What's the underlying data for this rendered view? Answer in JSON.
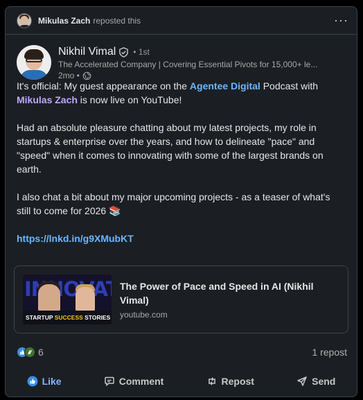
{
  "repost_bar": {
    "reposter_name": "Mikulas Zach",
    "action_text": "reposted this",
    "more_label": "···"
  },
  "author": {
    "name": "Nikhil Vimal",
    "degree": "• 1st",
    "headline": "The Accelerated Company | Covering Essential Pivots for 15,000+ le...",
    "time": "2mo •"
  },
  "post": {
    "p1_a": "It's official: My guest appearance on the ",
    "p1_mention_company": "Agentee Digital",
    "p1_b": " Podcast with ",
    "p1_mention_person": "Mikulas Zach",
    "p1_c": " is now live on YouTube!",
    "p2": "Had an absolute pleasure chatting about my latest projects, my role in startups & enterprise over the years, and how to delineate \"pace\" and \"speed\" when it comes to innovating with some of the largest brands on earth.",
    "p3": "I also chat a bit about my major upcoming projects - as a teaser of what's still to come for 2026 📚",
    "link": "https://lnkd.in/g9XMubKT"
  },
  "preview": {
    "thumb_title": "INNOVATION",
    "thumb_caption_a": "STARTUP ",
    "thumb_caption_b": "SUCCESS",
    "thumb_caption_c": " STORIES",
    "title": "The Power of Pace and Speed in AI (Nikhil Vimal)",
    "domain": "youtube.com"
  },
  "social": {
    "reaction_count": "6",
    "repost_count": "1 repost"
  },
  "actions": {
    "like": "Like",
    "comment": "Comment",
    "repost": "Repost",
    "send": "Send"
  },
  "colors": {
    "card_bg": "#1b1f23",
    "border": "#38434f",
    "link_blue": "#6cb6ff",
    "mention_purple": "#c0a7ff",
    "like_blue": "#378fe9"
  },
  "icons": [
    "verified-shield-icon",
    "globe-icon",
    "like-reaction-icon",
    "clap-reaction-icon",
    "thumbs-up-icon",
    "comment-icon",
    "repost-icon",
    "send-icon"
  ]
}
